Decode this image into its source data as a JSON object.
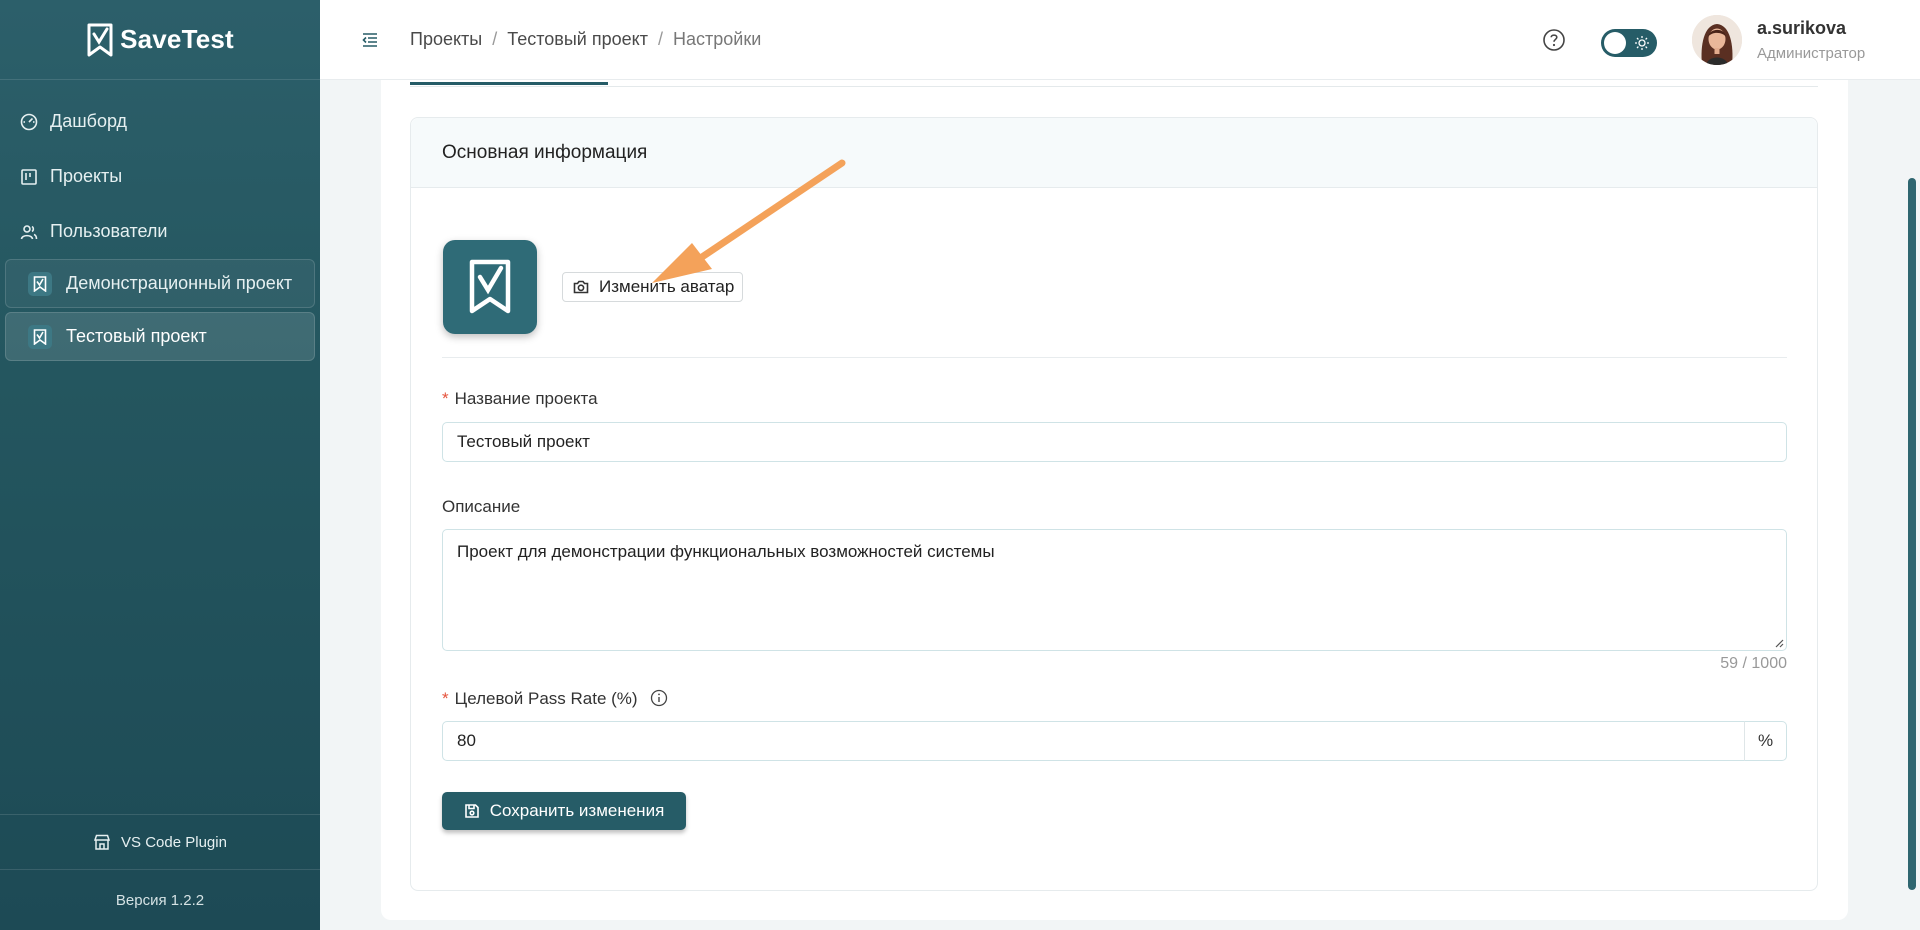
{
  "app": {
    "name": "SaveTest"
  },
  "sidebar": {
    "nav": [
      {
        "label": "Дашборд",
        "icon": "gauge-icon"
      },
      {
        "label": "Проекты",
        "icon": "kanban-icon"
      },
      {
        "label": "Пользователи",
        "icon": "users-icon"
      }
    ],
    "projects": [
      {
        "label": "Демонстрационный проект",
        "active": false
      },
      {
        "label": "Тестовый проект",
        "active": true
      }
    ],
    "plugin_label": "VS Code Plugin",
    "version": "Версия 1.2.2"
  },
  "header": {
    "breadcrumb": [
      "Проекты",
      "Тестовый проект",
      "Настройки"
    ],
    "separator": "/",
    "user": {
      "name": "a.surikova",
      "role": "Администратор"
    }
  },
  "panel": {
    "title": "Основная информация",
    "change_avatar_label": "Изменить аватар",
    "fields": {
      "name": {
        "label": "Название проекта",
        "required": "*",
        "value": "Тестовый проект"
      },
      "description": {
        "label": "Описание",
        "value": "Проект для демонстрации функциональных возможностей системы",
        "counter": "59 / 1000"
      },
      "pass_rate": {
        "label": "Целевой Pass Rate (%)",
        "required": "*",
        "value": "80",
        "suffix": "%"
      }
    },
    "save_label": "Сохранить изменения"
  },
  "colors": {
    "brand": "#265c67",
    "sidebar": "#2c5f6a",
    "annotation_arrow": "#f4a25a",
    "required": "#e5533c"
  }
}
